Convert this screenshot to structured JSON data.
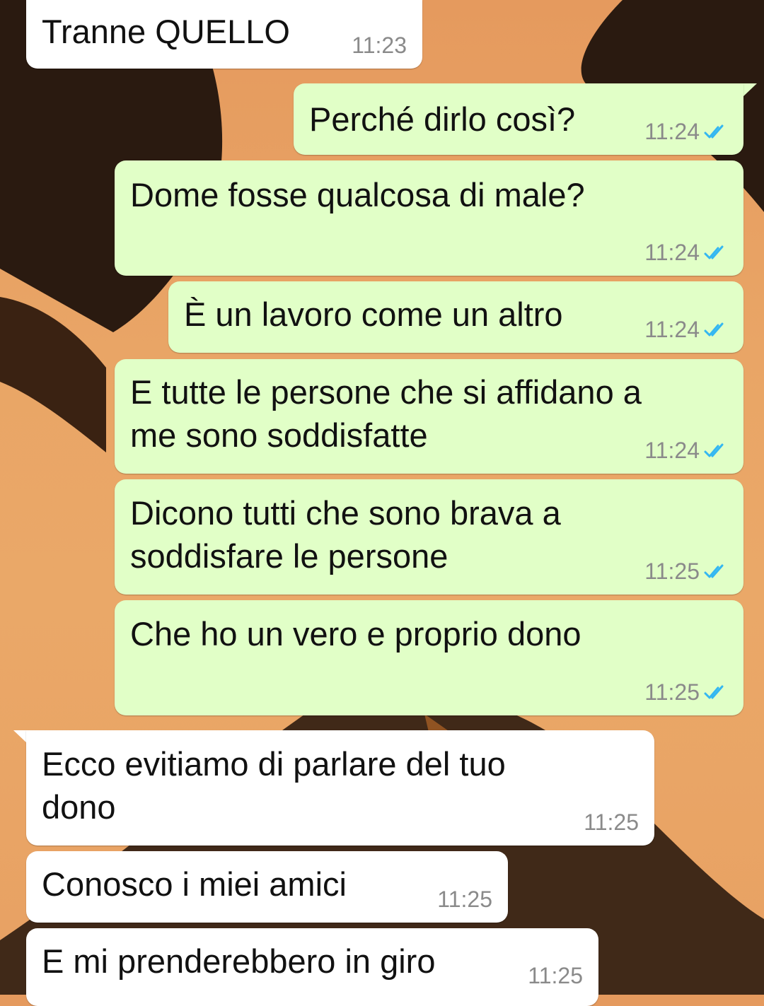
{
  "colors": {
    "incoming_bubble": "#ffffff",
    "outgoing_bubble": "#e1ffc7",
    "timestamp": "#8a8a8a",
    "read_ticks": "#34b7f1"
  },
  "messages": [
    {
      "direction": "incoming",
      "text": "Tranne QUELLO",
      "time": "11:23"
    },
    {
      "direction": "outgoing",
      "text": "Perché dirlo così?",
      "time": "11:24",
      "status_icon": "double-check-read-icon"
    },
    {
      "direction": "outgoing",
      "text": "Dome fosse qualcosa di male?",
      "time": "11:24",
      "status_icon": "double-check-read-icon"
    },
    {
      "direction": "outgoing",
      "text": "È un lavoro come un altro",
      "time": "11:24",
      "status_icon": "double-check-read-icon"
    },
    {
      "direction": "outgoing",
      "text": "E tutte le persone che si affidano a\nme sono soddisfatte",
      "time": "11:24",
      "status_icon": "double-check-read-icon"
    },
    {
      "direction": "outgoing",
      "text": "Dicono tutti che sono brava a\nsoddisfare le persone",
      "time": "11:25",
      "status_icon": "double-check-read-icon"
    },
    {
      "direction": "outgoing",
      "text": "Che ho un vero e proprio dono",
      "time": "11:25",
      "status_icon": "double-check-read-icon"
    },
    {
      "direction": "incoming",
      "text": "Ecco evitiamo di parlare del tuo\ndono",
      "time": "11:25"
    },
    {
      "direction": "incoming",
      "text": "Conosco i miei amici",
      "time": "11:25"
    },
    {
      "direction": "incoming",
      "text": "E mi prenderebbero in giro",
      "time": "11:25"
    }
  ]
}
